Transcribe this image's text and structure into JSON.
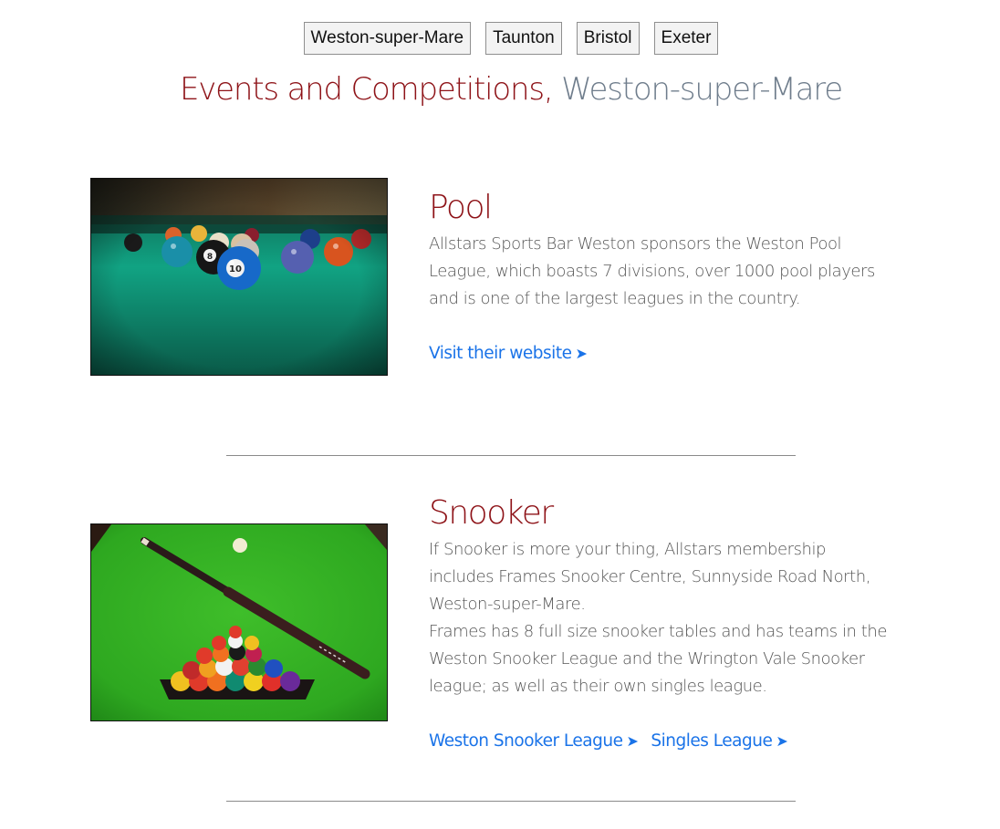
{
  "city_nav": [
    "Weston-super-Mare",
    "Taunton",
    "Bristol",
    "Exeter"
  ],
  "page_title": {
    "main": "Events and Competitions,",
    "city": "Weston-super-Mare"
  },
  "sections": [
    {
      "heading": "Pool",
      "description": [
        "Allstars Sports Bar Weston sponsors the Weston Pool League, which boasts 7 divisions, over 1000 pool players and is one of the largest leagues in the country."
      ],
      "links": [
        {
          "label": "Visit their website",
          "arrow": "➤"
        }
      ],
      "image": "pool-balls-photo"
    },
    {
      "heading": "Snooker",
      "description": [
        "If Snooker is more your thing, Allstars membership includes Frames Snooker Centre, Sunnyside Road North, Weston-super-Mare.",
        "Frames has 8 full size snooker tables and has teams in the Weston Snooker League and the Wrington Vale Snooker league; as well as their own singles league."
      ],
      "links": [
        {
          "label": "Weston Snooker League",
          "arrow": "➤"
        },
        {
          "label": "Singles League",
          "arrow": "➤"
        }
      ],
      "image": "snooker-cue-and-balls-photo"
    }
  ],
  "colors": {
    "heading": "#8e1318",
    "city": "#6f7d8c",
    "link": "#1a73e8"
  }
}
